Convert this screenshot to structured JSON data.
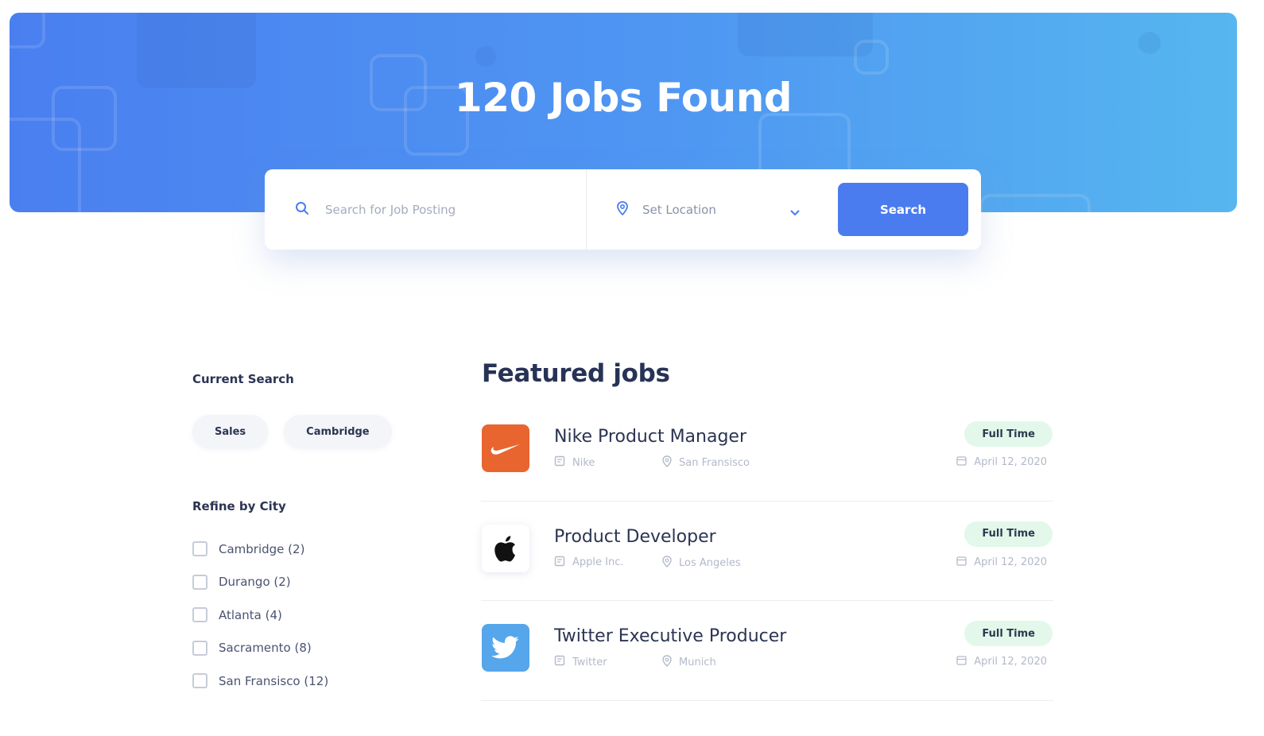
{
  "hero": {
    "title": "120 Jobs Found"
  },
  "search": {
    "keyword_placeholder": "Search for Job Posting",
    "location_label": "Set Location",
    "button_label": "Search"
  },
  "sidebar": {
    "current_search_heading": "Current Search",
    "chips": [
      "Sales",
      "Cambridge"
    ],
    "refine_heading": "Refine by City",
    "cities": [
      "Cambridge (2)",
      "Durango (2)",
      "Atlanta (4)",
      "Sacramento (8)",
      "San Fransisco (12)"
    ]
  },
  "featured": {
    "heading": "Featured jobs",
    "jobs": [
      {
        "title": "Nike Product Manager",
        "company": "Nike",
        "location": "San Fransisco",
        "type": "Full Time",
        "date": "April 12, 2020",
        "logo_icon": "nike-swoosh-icon",
        "logo_color": "#e9652f"
      },
      {
        "title": "Product Developer",
        "company": "Apple Inc.",
        "location": "Los Angeles",
        "type": "Full Time",
        "date": "April 12, 2020",
        "logo_icon": "apple-icon",
        "logo_color": "#ffffff"
      },
      {
        "title": "Twitter Executive Producer",
        "company": "Twitter",
        "location": "Munich",
        "type": "Full Time",
        "date": "April 12, 2020",
        "logo_icon": "twitter-bird-icon",
        "logo_color": "#55a6ea"
      }
    ]
  },
  "colors": {
    "accent": "#4a7cf0",
    "badge_bg": "#e3f8ea",
    "heading": "#273256"
  }
}
